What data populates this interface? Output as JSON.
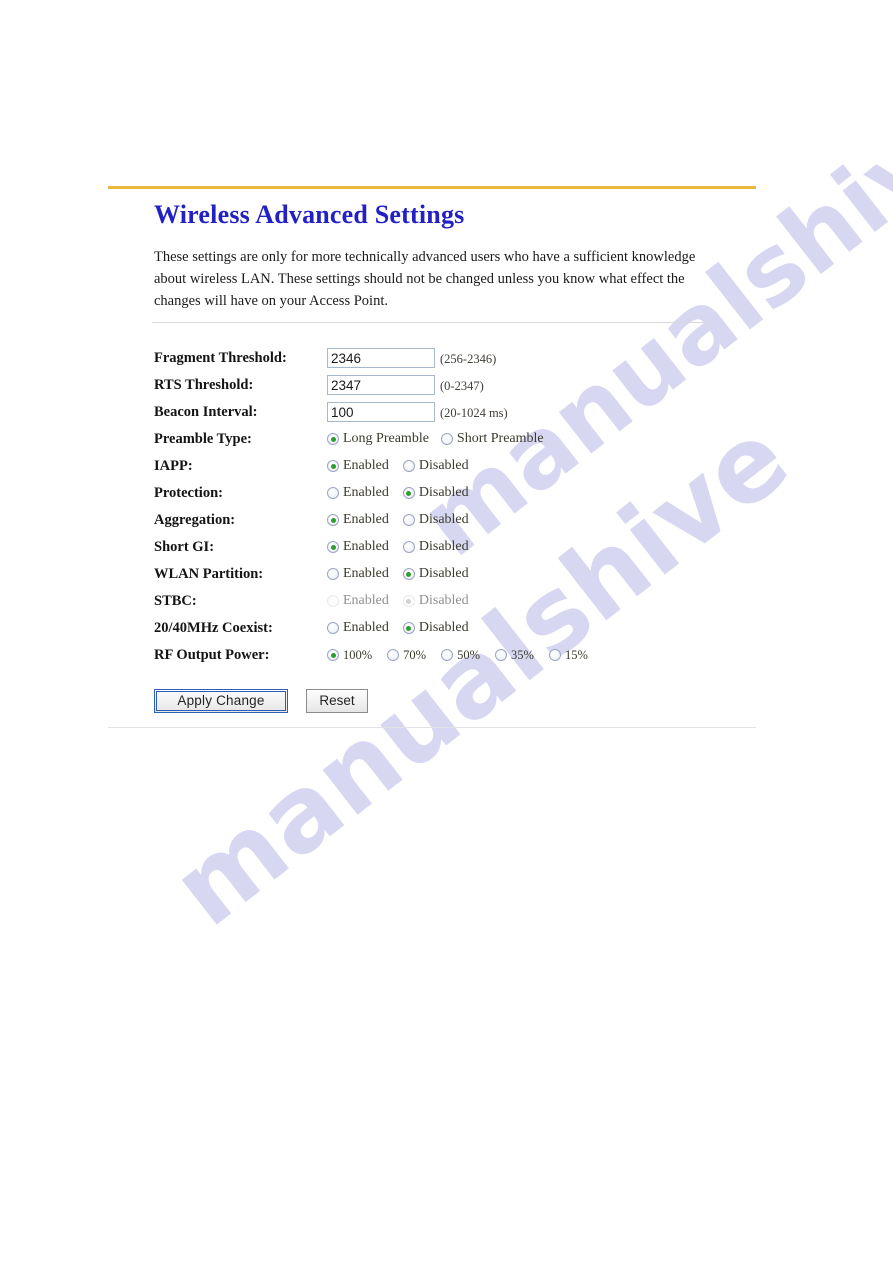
{
  "page": {
    "title": "Wireless Advanced Settings",
    "description": "These settings are only for more technically advanced users who have a sufficient knowledge about wireless LAN. These settings should not be changed unless you know what effect the changes will have on your Access Point.",
    "accent_rule_color": "#e8b93c",
    "title_color": "#2321c4"
  },
  "watermark": {
    "text_top": "manualshive.com",
    "text_bottom": "manualshive"
  },
  "form": {
    "fields": [
      {
        "id": "fragment-threshold",
        "label": "Fragment Threshold:",
        "type": "text",
        "value": "2346",
        "hint": "(256-2346)"
      },
      {
        "id": "rts-threshold",
        "label": "RTS Threshold:",
        "type": "text",
        "value": "2347",
        "hint": "(0-2347)"
      },
      {
        "id": "beacon-interval",
        "label": "Beacon Interval:",
        "type": "text",
        "value": "100",
        "hint": "(20-1024 ms)"
      },
      {
        "id": "preamble-type",
        "label": "Preamble Type:",
        "type": "radio",
        "disabled": false,
        "options": [
          {
            "label": "Long Preamble",
            "checked": true
          },
          {
            "label": "Short Preamble",
            "checked": false
          }
        ]
      },
      {
        "id": "iapp",
        "label": "IAPP:",
        "type": "radio",
        "disabled": false,
        "options": [
          {
            "label": "Enabled",
            "checked": true
          },
          {
            "label": "Disabled",
            "checked": false
          }
        ]
      },
      {
        "id": "protection",
        "label": "Protection:",
        "type": "radio",
        "disabled": false,
        "options": [
          {
            "label": "Enabled",
            "checked": false
          },
          {
            "label": "Disabled",
            "checked": true
          }
        ]
      },
      {
        "id": "aggregation",
        "label": "Aggregation:",
        "type": "radio",
        "disabled": false,
        "options": [
          {
            "label": "Enabled",
            "checked": true
          },
          {
            "label": "Disabled",
            "checked": false
          }
        ]
      },
      {
        "id": "short-gi",
        "label": "Short GI:",
        "type": "radio",
        "disabled": false,
        "options": [
          {
            "label": "Enabled",
            "checked": true
          },
          {
            "label": "Disabled",
            "checked": false
          }
        ]
      },
      {
        "id": "wlan-partition",
        "label": "WLAN Partition:",
        "type": "radio",
        "disabled": false,
        "options": [
          {
            "label": "Enabled",
            "checked": false
          },
          {
            "label": "Disabled",
            "checked": true
          }
        ]
      },
      {
        "id": "stbc",
        "label": "STBC:",
        "type": "radio",
        "disabled": true,
        "options": [
          {
            "label": "Enabled",
            "checked": false
          },
          {
            "label": "Disabled",
            "checked": true
          }
        ]
      },
      {
        "id": "coexist-20-40mhz",
        "label": "20/40MHz Coexist:",
        "type": "radio",
        "disabled": false,
        "options": [
          {
            "label": "Enabled",
            "checked": false
          },
          {
            "label": "Disabled",
            "checked": true
          }
        ]
      },
      {
        "id": "rf-output-power",
        "label": "RF Output Power:",
        "type": "radio",
        "disabled": false,
        "variant": "power",
        "options": [
          {
            "label": "100%",
            "checked": true
          },
          {
            "label": "70%",
            "checked": false
          },
          {
            "label": "50%",
            "checked": false
          },
          {
            "label": "35%",
            "checked": false
          },
          {
            "label": "15%",
            "checked": false
          }
        ]
      }
    ]
  },
  "buttons": {
    "apply": "Apply Change",
    "reset": "Reset"
  }
}
